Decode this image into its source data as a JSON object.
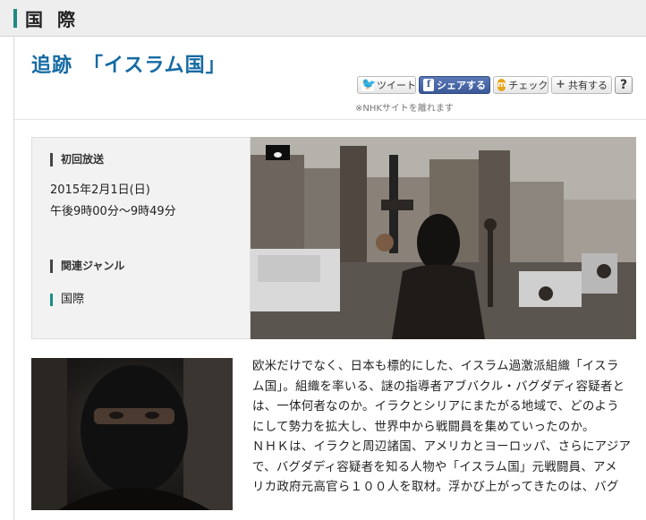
{
  "section": {
    "title": "国際"
  },
  "program": {
    "title": "追跡　「イスラム国」"
  },
  "share": {
    "tweet": "ツイート",
    "facebook": "シェアする",
    "check": "チェック",
    "share": "共有する",
    "help": "?",
    "note": "※NHKサイトを離れます"
  },
  "info": {
    "first_broadcast_label": "初回放送",
    "date": "2015年2月1日(日)",
    "time": "午後9時00分～9時49分",
    "genre_label": "関連ジャンル",
    "genre": "国際"
  },
  "article": {
    "lines": [
      "欧米だけでなく、日本も標的にした、イスラム過激派組織「イスラ",
      "ム国」。組織を率いる、謎の指導者アブバクル・バグダディ容疑者と",
      "は、一体何者なのか。イラクとシリアにまたがる地域で、どのよう",
      "にして勢力を拡大し、世界中から戦闘員を集めていったのか。",
      "ＮＨＫは、イラクと周辺諸国、アメリカとヨーロッパ、さらにアジア",
      "で、バグダディ容疑者を知る人物や「イスラム国」元戦闘員、アメ",
      "リカ政府元高官ら１００人を取材。浮かび上がってきたのは、バグ"
    ]
  },
  "colors": {
    "accent": "#1f8a83",
    "title_blue": "#156aa3",
    "facebook": "#3b5998"
  }
}
